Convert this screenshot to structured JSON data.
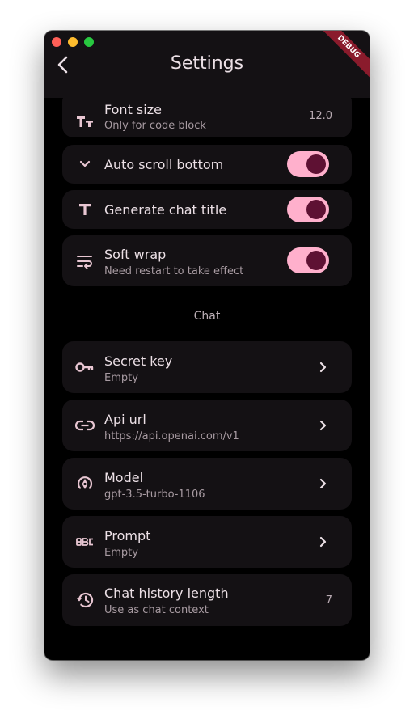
{
  "window": {
    "title": "Settings",
    "debug_banner": "DEBUG"
  },
  "settings": {
    "font_size": {
      "label": "Font size",
      "subtitle": "Only for code block",
      "value": "12.0"
    },
    "auto_scroll": {
      "label": "Auto scroll bottom",
      "enabled": true
    },
    "generate_title": {
      "label": "Generate chat title",
      "enabled": true
    },
    "soft_wrap": {
      "label": "Soft wrap",
      "subtitle": "Need restart to take effect",
      "enabled": true
    }
  },
  "chat_section": {
    "header": "Chat",
    "secret_key": {
      "label": "Secret key",
      "subtitle": "Empty"
    },
    "api_url": {
      "label": "Api url",
      "subtitle": "https://api.openai.com/v1"
    },
    "model": {
      "label": "Model",
      "subtitle": "gpt-3.5-turbo-1106"
    },
    "prompt": {
      "label": "Prompt",
      "subtitle": "Empty"
    },
    "history_length": {
      "label": "Chat history length",
      "subtitle": "Use as chat context",
      "value": "7"
    }
  },
  "colors": {
    "background": "#000000",
    "card": "#141114",
    "toggle_track": "#ffb0cc",
    "toggle_knob": "#5e1133",
    "icon": "#e8c6d2",
    "debug_banner": "#8a1b2c"
  }
}
